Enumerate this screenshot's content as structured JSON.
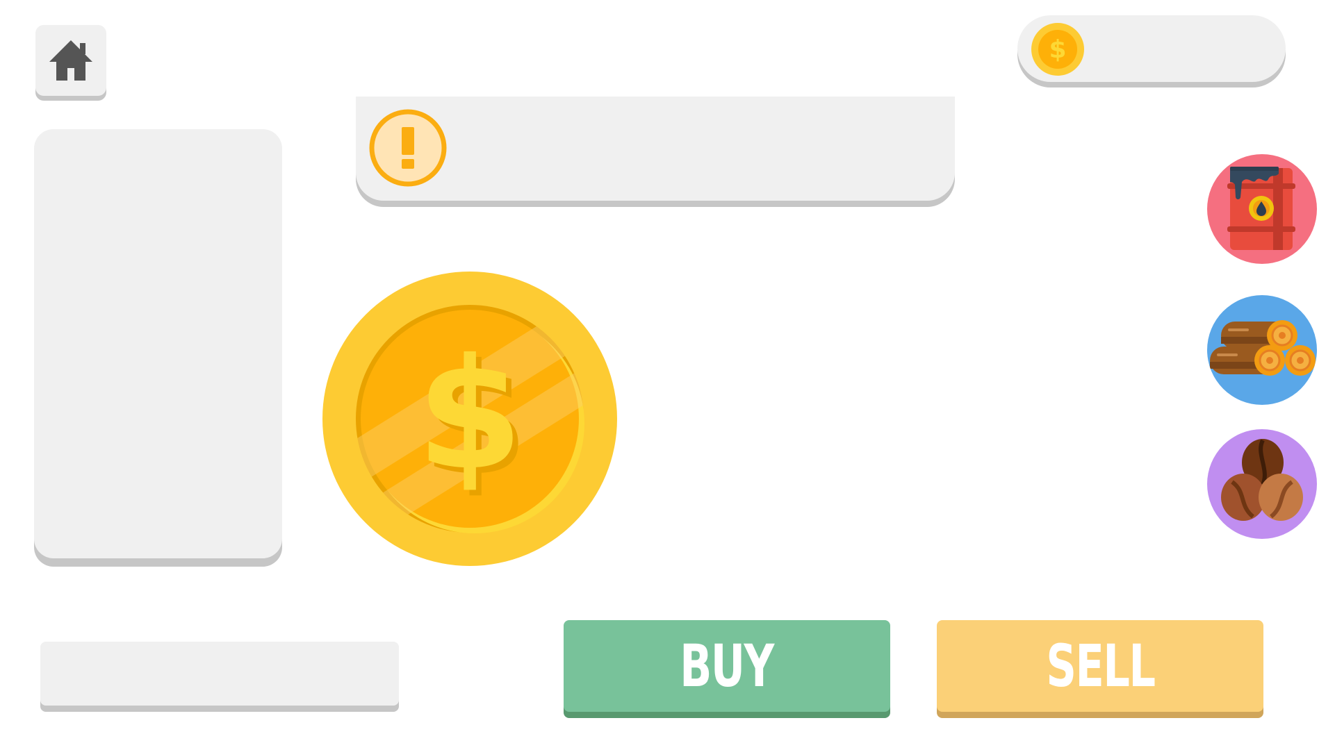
{
  "header": {
    "home_icon": "home-icon"
  },
  "balance": {
    "coin_icon": "dollar-coin-icon",
    "value": ""
  },
  "message": {
    "alert_icon": "exclamation-icon",
    "text": ""
  },
  "main_coin": {
    "icon": "dollar-coin-icon"
  },
  "resources": [
    {
      "name": "oil",
      "icon": "oil-barrel-icon",
      "color": "#f56f80"
    },
    {
      "name": "wood",
      "icon": "wood-logs-icon",
      "color": "#5aa7e8"
    },
    {
      "name": "coffee",
      "icon": "coffee-beans-icon",
      "color": "#c08ef0"
    }
  ],
  "amount": {
    "value": ""
  },
  "actions": {
    "buy_label": "BUY",
    "buy_color": "#78c29a",
    "sell_label": "SELL",
    "sell_color": "#fbd077"
  },
  "colors": {
    "panel": "#f0f0f0",
    "panel_shadow": "#c6c6c6",
    "coin_outer": "#fdcb33",
    "coin_inner": "#feb008",
    "alert": "#fbad11"
  }
}
